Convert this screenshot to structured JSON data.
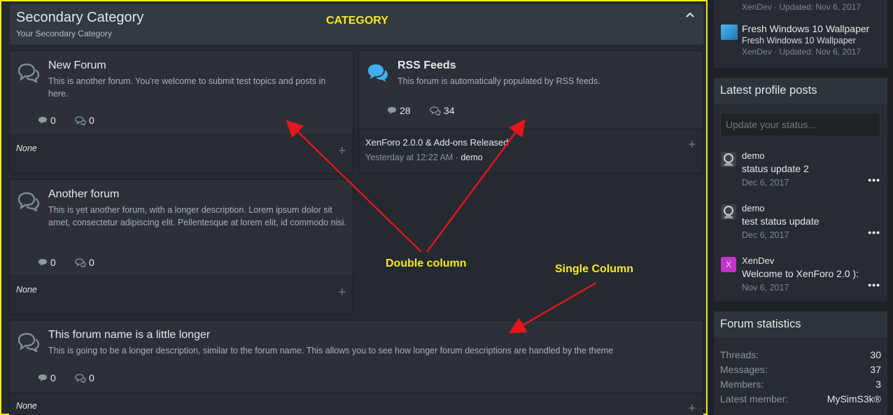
{
  "category": {
    "title": "Secondary Category",
    "description": "Your Secondary Category"
  },
  "annotations": {
    "category": "CATEGORY",
    "double_column": "Double column",
    "single_column": "Single Column"
  },
  "forums": [
    {
      "title": "New Forum",
      "description": "This is another forum. You're welcome to submit test topics and posts in here.",
      "threads": "0",
      "messages": "0",
      "latest": "None"
    },
    {
      "title": "RSS Feeds",
      "description": "This forum is automatically populated by RSS feeds.",
      "threads": "28",
      "messages": "34",
      "latest_title": "XenForo 2.0.0 & Add-ons Released",
      "latest_date": "Yesterday at 12:22 AM",
      "latest_user": "demo"
    },
    {
      "title": "Another forum",
      "description": "This is yet another forum, with a longer description. Lorem ipsum dolor sit amet, consectetur adipiscing elit. Pellentesque at lorem elit, id commodo nisi.",
      "threads": "0",
      "messages": "0",
      "latest": "None"
    },
    {
      "title": "This forum name is a little longer",
      "description": "This is going to be a longer description, similar to the forum name. This allows you to see how longer forum descriptions are handled by the theme",
      "threads": "0",
      "messages": "0",
      "latest": "None"
    }
  ],
  "sidebar": {
    "resources": [
      {
        "meta": "XenDev · Updated: Nov 6, 2017"
      },
      {
        "title": "Fresh Windows 10 Wallpaper",
        "subtitle": "Fresh Windows 10 Wallpaper",
        "meta": "XenDev · Updated: Nov 6, 2017"
      }
    ],
    "profile_posts": {
      "title": "Latest profile posts",
      "placeholder": "Update your status...",
      "posts": [
        {
          "user": "demo",
          "text": "status update 2",
          "date": "Dec 6, 2017",
          "more": "•••"
        },
        {
          "user": "demo",
          "text": "test status update",
          "date": "Dec 6, 2017",
          "more": "•••"
        },
        {
          "user": "XenDev",
          "avatar_letter": "X",
          "text": "Welcome to XenForo 2.0 ):",
          "date": "Nov 6, 2017",
          "more": "•••"
        }
      ]
    },
    "forum_statistics": {
      "title": "Forum statistics",
      "rows": [
        {
          "label": "Threads:",
          "value": "30"
        },
        {
          "label": "Messages:",
          "value": "37"
        },
        {
          "label": "Members:",
          "value": "3"
        },
        {
          "label": "Latest member:",
          "value": "MySimS3k®"
        }
      ]
    }
  },
  "colors": {
    "annotation_yellow": "#f5ec1e",
    "arrow_red": "#e8141c",
    "rss_icon": "#3fb0ee",
    "xendev_avatar": "#c433c9"
  }
}
